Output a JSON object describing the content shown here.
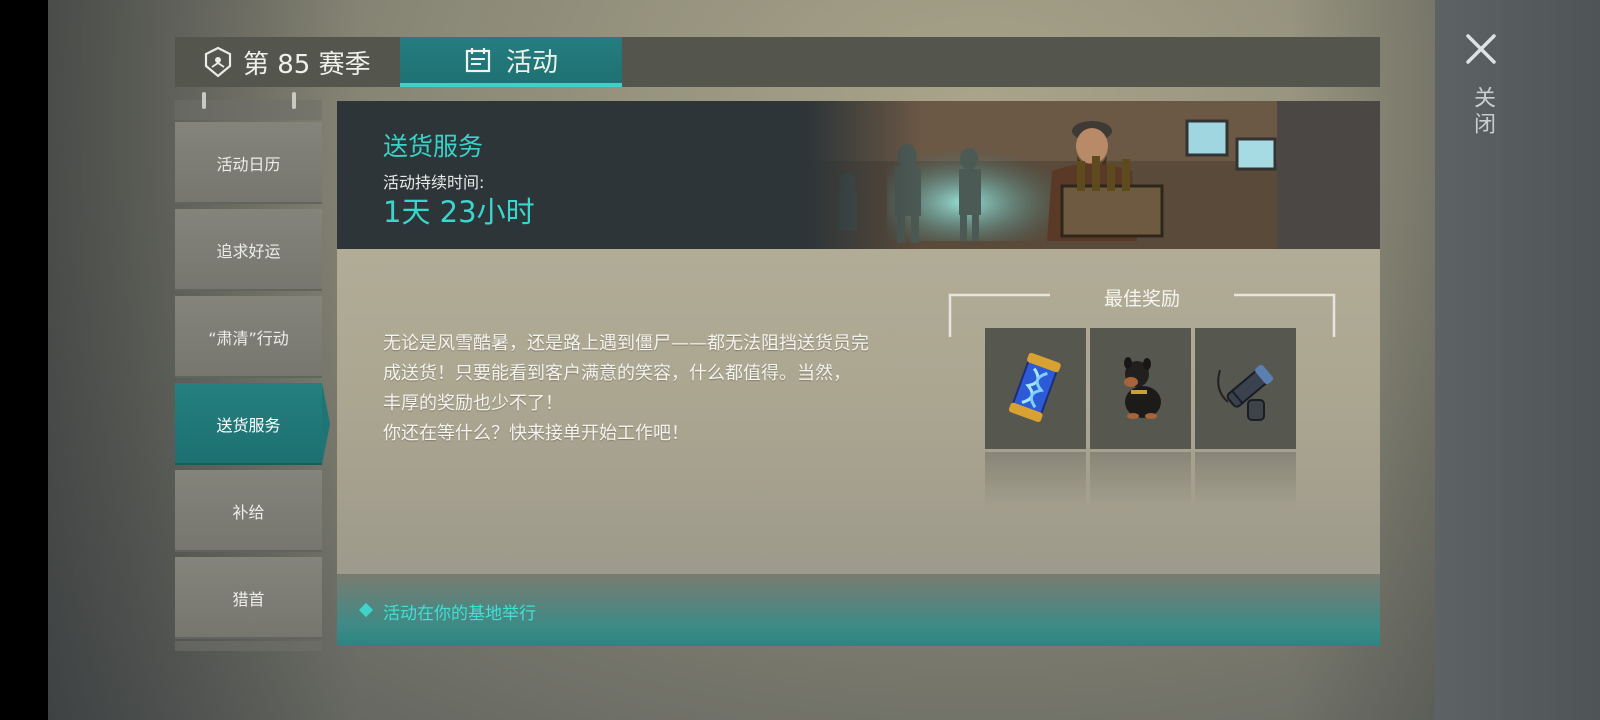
{
  "header": {
    "season_tab_label": "第 85 赛季",
    "events_tab_label": "活动"
  },
  "close": {
    "label": "关闭"
  },
  "sidebar": {
    "items": [
      {
        "label": "活动日历",
        "active": false
      },
      {
        "label": "追求好运",
        "active": false
      },
      {
        "label": "“肃清”行动",
        "active": false
      },
      {
        "label": "送货服务",
        "active": true
      },
      {
        "label": "补给",
        "active": false
      },
      {
        "label": "猎首",
        "active": false
      }
    ]
  },
  "event": {
    "title": "送货服务",
    "duration_label": "活动持续时间:",
    "duration_value": "1天 23小时",
    "description": [
      "无论是风雪酷暑，还是路上遇到僵尸——都无法阻挡送货员完",
      "成送货！只要能看到客户满意的笑容，什么都值得。当然，",
      "丰厚的奖励也少不了！",
      "你还在等什么？快来接单开始工作吧！"
    ],
    "location_note": "活动在你的基地举行"
  },
  "rewards": {
    "title": "最佳奖励",
    "items": [
      {
        "icon": "dna-capsule-icon"
      },
      {
        "icon": "rottweiler-dog-icon"
      },
      {
        "icon": "whistle-flashlight-icon"
      }
    ]
  },
  "colors": {
    "accent": "#39d2c9",
    "active_tab": "#1f7173",
    "panel_bg": "#b8b29d",
    "banner_bg": "#2d3538"
  }
}
